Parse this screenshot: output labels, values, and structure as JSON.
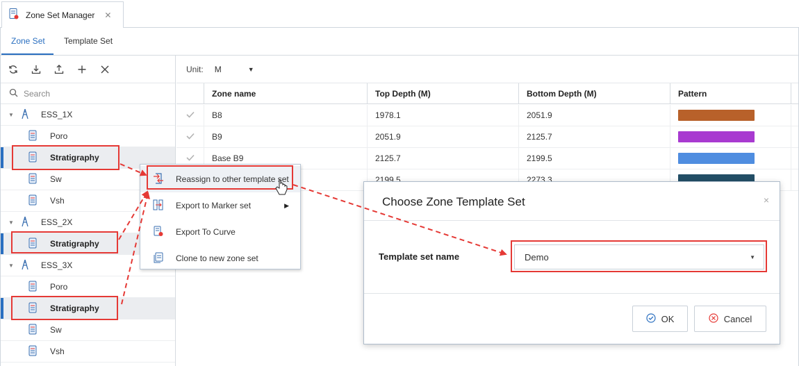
{
  "window": {
    "tab_title": "Zone Set Manager",
    "tab_close": "✕"
  },
  "tabs": [
    {
      "label": "Zone Set"
    },
    {
      "label": "Template Set"
    }
  ],
  "search": {
    "placeholder": "Search"
  },
  "unit": {
    "label": "Unit:",
    "value": "M"
  },
  "tree": [
    {
      "type": "well",
      "label": "ESS_1X"
    },
    {
      "type": "item",
      "label": "Poro"
    },
    {
      "type": "item",
      "label": "Stratigraphy",
      "selected": true
    },
    {
      "type": "item",
      "label": "Sw"
    },
    {
      "type": "item",
      "label": "Vsh"
    },
    {
      "type": "well",
      "label": "ESS_2X"
    },
    {
      "type": "item",
      "label": "Stratigraphy",
      "selected": true
    },
    {
      "type": "well",
      "label": "ESS_3X"
    },
    {
      "type": "item",
      "label": "Poro"
    },
    {
      "type": "item",
      "label": "Stratigraphy",
      "selected": true
    },
    {
      "type": "item",
      "label": "Sw"
    },
    {
      "type": "item",
      "label": "Vsh"
    }
  ],
  "grid": {
    "columns": [
      "Zone name",
      "Top Depth (M)",
      "Bottom Depth (M)",
      "Pattern"
    ],
    "rows": [
      {
        "zone": "B8",
        "top": "1978.1",
        "bottom": "2051.9",
        "color": "#b8612a"
      },
      {
        "zone": "B9",
        "top": "2051.9",
        "bottom": "2125.7",
        "color": "#a83ad0"
      },
      {
        "zone": "Base B9",
        "top": "2125.7",
        "bottom": "2199.5",
        "color": "#4f8de0"
      },
      {
        "zone": "",
        "top": "2199.5",
        "bottom": "2273.3",
        "color": "#234e66"
      }
    ]
  },
  "context_menu": {
    "items": [
      {
        "label": "Reassign to other template set",
        "icon": "reassign-icon"
      },
      {
        "label": "Export to Marker set",
        "icon": "marker-export-icon",
        "submenu": true
      },
      {
        "label": "Export To Curve",
        "icon": "curve-export-icon"
      },
      {
        "label": "Clone to new zone set",
        "icon": "clone-icon"
      }
    ]
  },
  "dialog": {
    "title": "Choose Zone Template Set",
    "close": "×",
    "field_label": "Template set name",
    "selected_value": "Demo",
    "ok_label": "OK",
    "cancel_label": "Cancel"
  },
  "colors": {
    "accent": "#2a6fc0",
    "annotation": "#e53935"
  }
}
